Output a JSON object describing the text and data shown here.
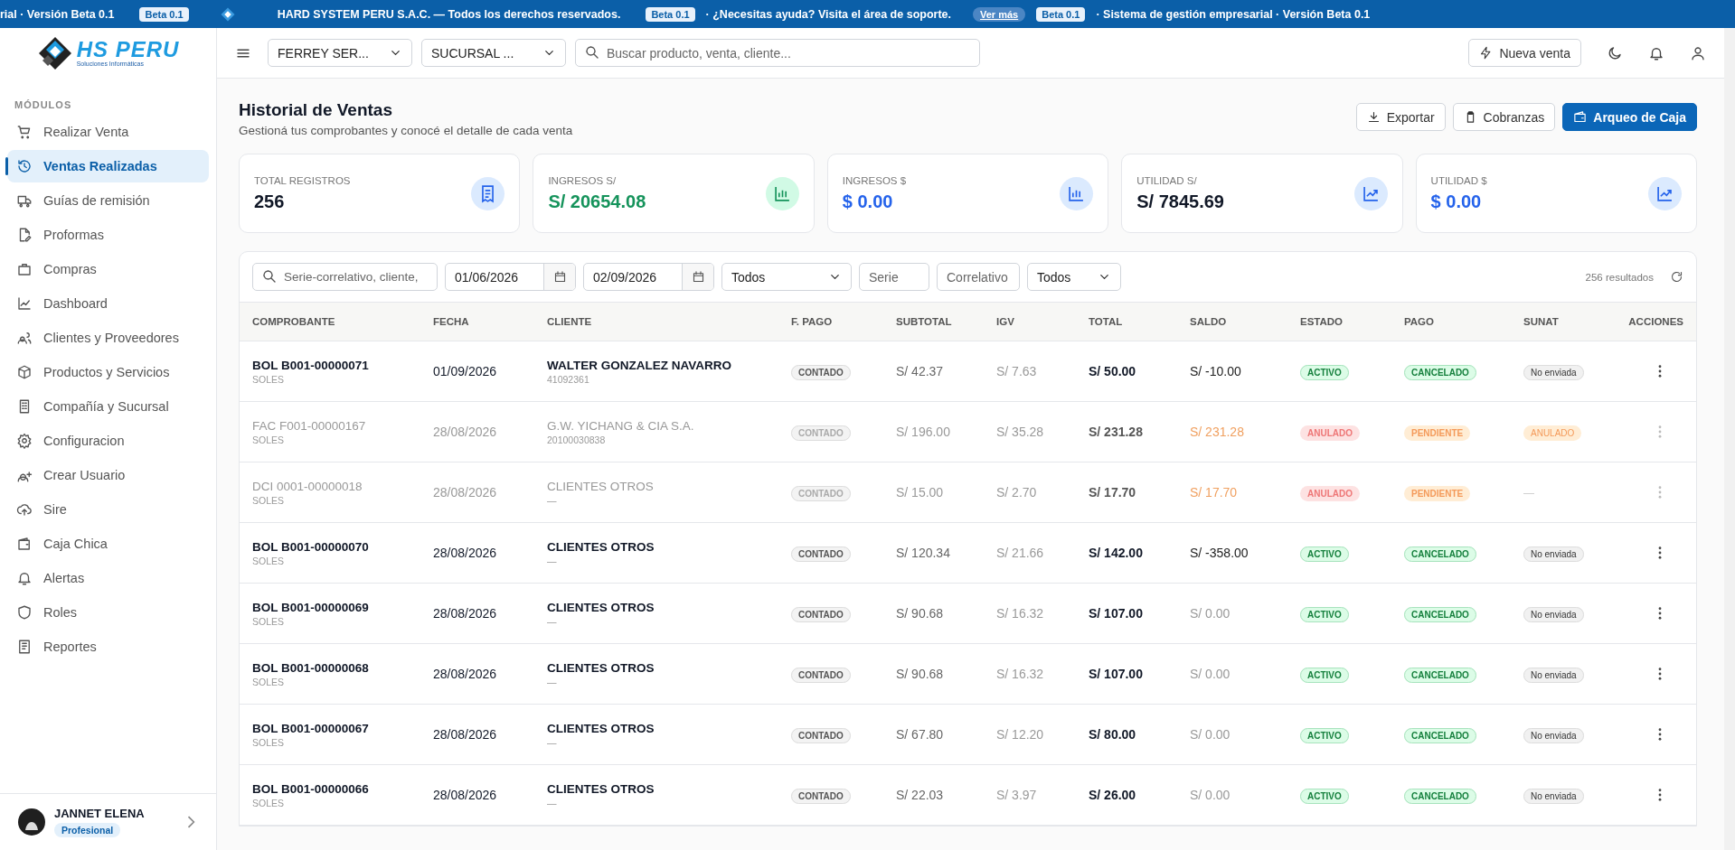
{
  "ticker": [
    {
      "kind": "text",
      "text": "rial · Versión Beta 0.1"
    },
    {
      "kind": "badge",
      "text": "Beta 0.1"
    },
    {
      "kind": "logo"
    },
    {
      "kind": "text",
      "text": "HARD SYSTEM PERU S.A.C. — Todos los derechos reservados."
    },
    {
      "kind": "badge",
      "text": "Beta 0.1"
    },
    {
      "kind": "text",
      "text": "· ¿Necesitas ayuda? Visita el área de soporte."
    },
    {
      "kind": "link",
      "text": "Ver más"
    },
    {
      "kind": "badge",
      "text": "Beta 0.1"
    },
    {
      "kind": "text",
      "text": "· Sistema de gestión empresarial · Versión Beta 0.1"
    }
  ],
  "brand": {
    "name": "HS PERU",
    "tagline": "Soluciones Informáticas"
  },
  "sidebar": {
    "section": "MÓDULOS",
    "items": [
      {
        "label": "Realizar Venta",
        "selected": false
      },
      {
        "label": "Ventas Realizadas",
        "selected": true
      },
      {
        "label": "Guías de remisión",
        "selected": false
      },
      {
        "label": "Proformas",
        "selected": false
      },
      {
        "label": "Compras",
        "selected": false
      },
      {
        "label": "Dashboard",
        "selected": false
      },
      {
        "label": "Clientes y Proveedores",
        "selected": false
      },
      {
        "label": "Productos y Servicios",
        "selected": false
      },
      {
        "label": "Compañía y Sucursal",
        "selected": false
      },
      {
        "label": "Configuracion",
        "selected": false
      },
      {
        "label": "Crear Usuario",
        "selected": false
      },
      {
        "label": "Sire",
        "selected": false
      },
      {
        "label": "Caja Chica",
        "selected": false
      },
      {
        "label": "Alertas",
        "selected": false
      },
      {
        "label": "Roles",
        "selected": false
      },
      {
        "label": "Reportes",
        "selected": false
      }
    ],
    "user": {
      "name": "JANNET ELENA",
      "role": "Profesional"
    }
  },
  "topbar": {
    "company": "FERREY SER...",
    "branch": "SUCURSAL ...",
    "search_placeholder": "Buscar producto, venta, cliente...",
    "new_sale": "Nueva venta"
  },
  "page": {
    "title": "Historial de Ventas",
    "subtitle": "Gestioná tus comprobantes y conocé el detalle de cada venta",
    "actions": [
      {
        "label": "Exportar",
        "kind": "outline"
      },
      {
        "label": "Cobranzas",
        "kind": "outline"
      },
      {
        "label": "Arqueo de Caja",
        "kind": "primary"
      }
    ]
  },
  "stats": [
    {
      "label": "TOTAL REGISTROS",
      "value": "256",
      "color": "#111827",
      "kind": "blue"
    },
    {
      "label": "INGRESOS S/",
      "value": "S/ 20654.08",
      "color": "#15935b",
      "kind": "green"
    },
    {
      "label": "INGRESOS $",
      "value": "$ 0.00",
      "color": "#2563eb",
      "kind": "blue"
    },
    {
      "label": "UTILIDAD S/",
      "value": "S/ 7845.69",
      "color": "#111827",
      "kind": "blue"
    },
    {
      "label": "UTILIDAD $",
      "value": "$ 0.00",
      "color": "#2563eb",
      "kind": "blue"
    }
  ],
  "filters": {
    "search_placeholder": "Serie-correlativo, cliente,",
    "date_from": "01/06/2026",
    "date_to": "02/09/2026",
    "type": "Todos",
    "serie_placeholder": "Serie",
    "correlativo_placeholder": "Correlativo",
    "status": "Todos",
    "results": "256 resultados"
  },
  "table": {
    "columns": [
      "COMPROBANTE",
      "FECHA",
      "CLIENTE",
      "F. PAGO",
      "SUBTOTAL",
      "IGV",
      "TOTAL",
      "SALDO",
      "ESTADO",
      "PAGO",
      "SUNAT",
      "ACCIONES"
    ],
    "rows": [
      {
        "comprobante": "BOL B001-00000071",
        "moneda": "SOLES",
        "fecha": "01/09/2026",
        "cliente": "WALTER GONZALEZ NAVARRO",
        "doc": "41092361",
        "f_pago": "CONTADO",
        "subtotal": "S/ 42.37",
        "igv": "S/ 7.63",
        "total": "S/ 50.00",
        "saldo": {
          "text": "S/ -10.00",
          "kind": "negative"
        },
        "estado": {
          "text": "ACTIVO",
          "kind": "success"
        },
        "pago": {
          "text": "CANCELADO",
          "kind": "success"
        },
        "sunat": {
          "text": "No enviada",
          "kind": "neutral"
        },
        "dimmed": false
      },
      {
        "comprobante": "FAC F001-00000167",
        "moneda": "SOLES",
        "fecha": "28/08/2026",
        "cliente": "G.W. YICHANG & CIA S.A.",
        "doc": "20100030838",
        "f_pago": "CONTADO",
        "subtotal": "S/ 196.00",
        "igv": "S/ 35.28",
        "total": "S/ 231.28",
        "saldo": {
          "text": "S/ 231.28",
          "kind": "due"
        },
        "estado": {
          "text": "ANULADO",
          "kind": "danger"
        },
        "pago": {
          "text": "PENDIENTE",
          "kind": "warning"
        },
        "sunat": {
          "text": "ANULADO",
          "kind": "warning"
        },
        "dimmed": true
      },
      {
        "comprobante": "DCI 0001-00000018",
        "moneda": "SOLES",
        "fecha": "28/08/2026",
        "cliente": "CLIENTES OTROS",
        "doc": "—",
        "f_pago": "CONTADO",
        "subtotal": "S/ 15.00",
        "igv": "S/ 2.70",
        "total": "S/ 17.70",
        "saldo": {
          "text": "S/ 17.70",
          "kind": "due"
        },
        "estado": {
          "text": "ANULADO",
          "kind": "danger"
        },
        "pago": {
          "text": "PENDIENTE",
          "kind": "warning"
        },
        "sunat": {
          "text": "—",
          "kind": "none"
        },
        "dimmed": true
      },
      {
        "comprobante": "BOL B001-00000070",
        "moneda": "SOLES",
        "fecha": "28/08/2026",
        "cliente": "CLIENTES OTROS",
        "doc": "—",
        "f_pago": "CONTADO",
        "subtotal": "S/ 120.34",
        "igv": "S/ 21.66",
        "total": "S/ 142.00",
        "saldo": {
          "text": "S/ -358.00",
          "kind": "negative"
        },
        "estado": {
          "text": "ACTIVO",
          "kind": "success"
        },
        "pago": {
          "text": "CANCELADO",
          "kind": "success"
        },
        "sunat": {
          "text": "No enviada",
          "kind": "neutral"
        },
        "dimmed": false
      },
      {
        "comprobante": "BOL B001-00000069",
        "moneda": "SOLES",
        "fecha": "28/08/2026",
        "cliente": "CLIENTES OTROS",
        "doc": "—",
        "f_pago": "CONTADO",
        "subtotal": "S/ 90.68",
        "igv": "S/ 16.32",
        "total": "S/ 107.00",
        "saldo": {
          "text": "S/ 0.00",
          "kind": "zero"
        },
        "estado": {
          "text": "ACTIVO",
          "kind": "success"
        },
        "pago": {
          "text": "CANCELADO",
          "kind": "success"
        },
        "sunat": {
          "text": "No enviada",
          "kind": "neutral"
        },
        "dimmed": false
      },
      {
        "comprobante": "BOL B001-00000068",
        "moneda": "SOLES",
        "fecha": "28/08/2026",
        "cliente": "CLIENTES OTROS",
        "doc": "—",
        "f_pago": "CONTADO",
        "subtotal": "S/ 90.68",
        "igv": "S/ 16.32",
        "total": "S/ 107.00",
        "saldo": {
          "text": "S/ 0.00",
          "kind": "zero"
        },
        "estado": {
          "text": "ACTIVO",
          "kind": "success"
        },
        "pago": {
          "text": "CANCELADO",
          "kind": "success"
        },
        "sunat": {
          "text": "No enviada",
          "kind": "neutral"
        },
        "dimmed": false
      },
      {
        "comprobante": "BOL B001-00000067",
        "moneda": "SOLES",
        "fecha": "28/08/2026",
        "cliente": "CLIENTES OTROS",
        "doc": "—",
        "f_pago": "CONTADO",
        "subtotal": "S/ 67.80",
        "igv": "S/ 12.20",
        "total": "S/ 80.00",
        "saldo": {
          "text": "S/ 0.00",
          "kind": "zero"
        },
        "estado": {
          "text": "ACTIVO",
          "kind": "success"
        },
        "pago": {
          "text": "CANCELADO",
          "kind": "success"
        },
        "sunat": {
          "text": "No enviada",
          "kind": "neutral"
        },
        "dimmed": false
      },
      {
        "comprobante": "BOL B001-00000066",
        "moneda": "SOLES",
        "fecha": "28/08/2026",
        "cliente": "CLIENTES OTROS",
        "doc": "—",
        "f_pago": "CONTADO",
        "subtotal": "S/ 22.03",
        "igv": "S/ 3.97",
        "total": "S/ 26.00",
        "saldo": {
          "text": "S/ 0.00",
          "kind": "zero"
        },
        "estado": {
          "text": "ACTIVO",
          "kind": "success"
        },
        "pago": {
          "text": "CANCELADO",
          "kind": "success"
        },
        "sunat": {
          "text": "No enviada",
          "kind": "neutral"
        },
        "dimmed": false
      }
    ]
  }
}
